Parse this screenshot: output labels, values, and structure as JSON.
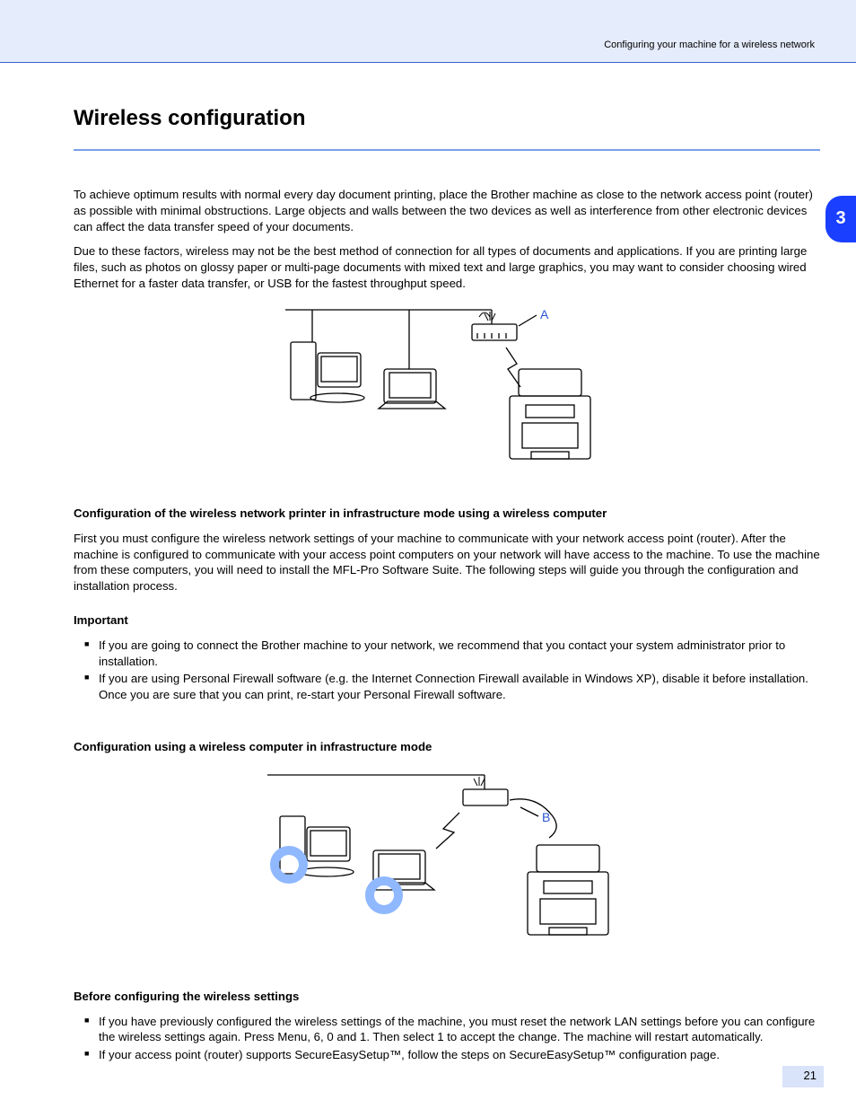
{
  "page": {
    "running_head": "Configuring your machine for a wireless network",
    "chapter_tab": "3",
    "number": "21"
  },
  "heading": "Wireless configuration",
  "para_intro": "To achieve optimum results with normal every day document printing, place the Brother machine as close to the network access point (router) as possible with minimal obstructions. Large objects and walls between the two devices as well as interference from other electronic devices can affect the data transfer speed of your documents.",
  "para_intro2": "Due to these factors, wireless may not be the best method of connection for all types of documents and applications. If you are printing large files, such as photos on glossy paper or multi-page documents with mixed text and large graphics, you may want to consider choosing wired Ethernet for a faster data transfer, or USB for the fastest throughput speed.",
  "sect1": {
    "title": "Configuration of the wireless network printer in infrastructure mode using a wireless computer",
    "intro": "First you must configure the wireless network settings of your machine to communicate with your network access point (router). After the machine is configured to communicate with your access point computers on your network will have access to the machine. To use the machine from these computers, you will need to install the MFL-Pro Software Suite. The following steps will guide you through the configuration and installation process.",
    "important_lead": "Important",
    "important_items": [
      "If you are going to connect the Brother machine to your network, we recommend that you contact your system administrator prior to installation.",
      "If you are using Personal Firewall software (e.g. the Internet Connection Firewall available in Windows XP), disable it before installation. Once you are sure that you can print, re-start your Personal Firewall software."
    ]
  },
  "sect2": {
    "title": "Configuration using a wireless computer in infrastructure mode",
    "fig_label_a": "A",
    "fig_label_b": "B",
    "before_lead": "Before configuring the wireless settings",
    "before_items": [
      "If you have previously configured the wireless settings of the machine, you must reset the network LAN settings before you can configure the wireless settings again. Press Menu, 6, 0 and 1. Then select 1 to accept the change. The machine will restart automatically.",
      "If your access point (router) supports SecureEasySetup™, follow the steps on SecureEasySetup™ configuration page."
    ]
  }
}
